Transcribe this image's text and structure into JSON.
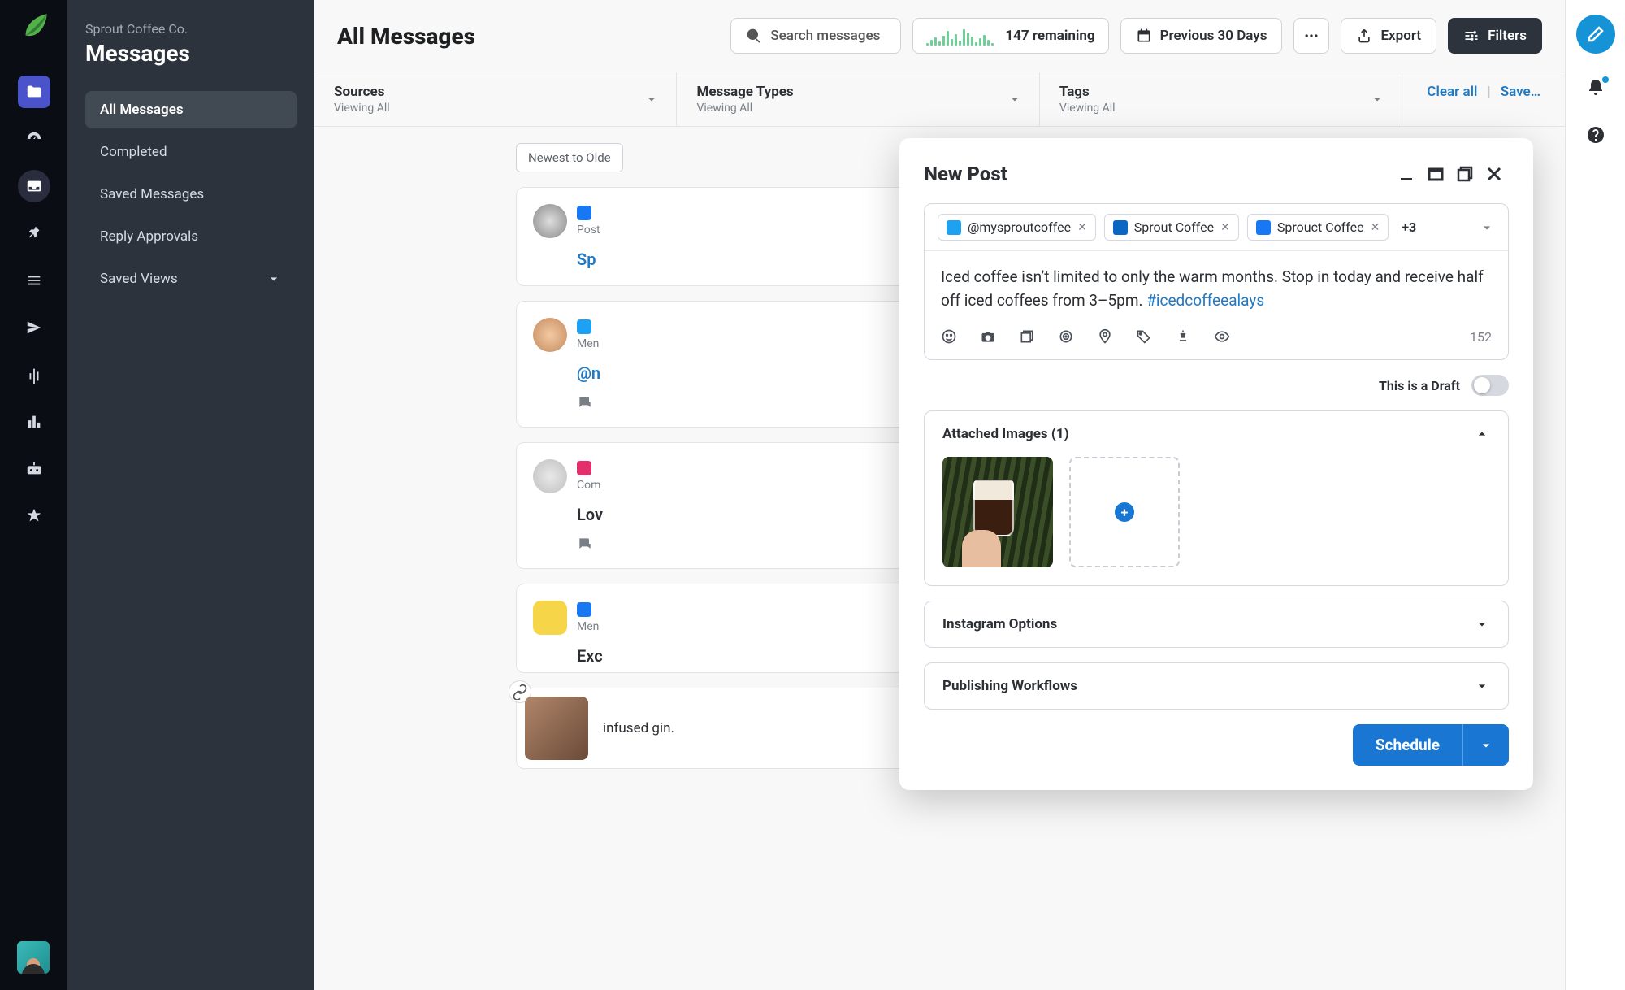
{
  "brand": {
    "company": "Sprout Coffee Co.",
    "section": "Messages"
  },
  "sidebar_items": [
    {
      "label": "All Messages",
      "active": true
    },
    {
      "label": "Completed"
    },
    {
      "label": "Saved Messages"
    },
    {
      "label": "Reply Approvals"
    },
    {
      "label": "Saved Views",
      "chevron": true
    }
  ],
  "header": {
    "title": "All Messages",
    "search_placeholder": "Search messages",
    "remaining": "147 remaining",
    "date_range": "Previous 30 Days",
    "export": "Export",
    "filters": "Filters"
  },
  "sparkline": [
    3,
    7,
    10,
    5,
    12,
    18,
    8,
    14,
    6,
    20,
    16,
    11,
    4,
    9,
    13,
    7,
    3
  ],
  "filter_row": {
    "sources": {
      "title": "Sources",
      "sub": "Viewing All"
    },
    "types": {
      "title": "Message Types",
      "sub": "Viewing All"
    },
    "tags": {
      "title": "Tags",
      "sub": "Viewing All"
    },
    "clear": "Clear all",
    "save": "Save…"
  },
  "sort": "Newest to Olde",
  "messages": [
    {
      "network": "fb",
      "meta": "Post",
      "body": "Sp",
      "body_color": "blue"
    },
    {
      "network": "tw",
      "meta": "Men",
      "body": "@n",
      "body_color": "blue",
      "foot": true
    },
    {
      "network": "ig",
      "meta": "Com",
      "body": "Lov",
      "body_color": "dark",
      "foot": true
    },
    {
      "network": "fb",
      "meta": "Men",
      "body": "Exc",
      "body_color": "dark"
    }
  ],
  "link_frag": "infused gin.",
  "modal": {
    "title": "New Post",
    "profiles": [
      {
        "net": "tw",
        "label": "@mysproutcoffee"
      },
      {
        "net": "li",
        "label": "Sprout Coffee"
      },
      {
        "net": "fb",
        "label": "Sprouct Coffee"
      }
    ],
    "more": "+3",
    "text_a": "Iced coffee isn’t limited to only the warm months. Stop in today and receive half off iced coffees from 3–5pm. ",
    "hashtag": "#icedcoffeealays",
    "char_count": "152",
    "draft_label": "This is a Draft",
    "attached_title": "Attached Images (1)",
    "instagram": "Instagram Options",
    "workflows": "Publishing Workflows",
    "schedule": "Schedule"
  }
}
